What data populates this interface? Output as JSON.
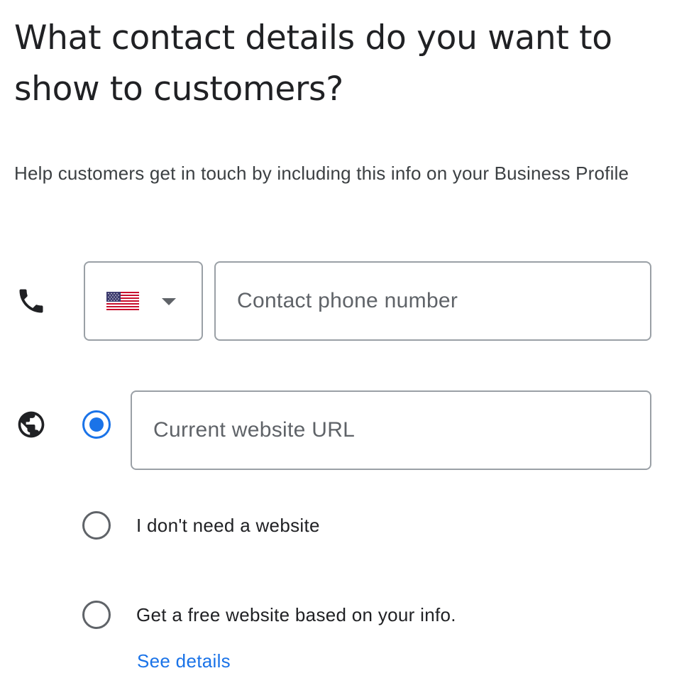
{
  "title": "What contact details do you want to show to customers?",
  "subtitle": "Help customers get in touch by including this info on your Business Profile",
  "phone": {
    "icon": "phone-icon",
    "country_flag": "us-flag-icon",
    "country_code": "US",
    "placeholder": "Contact phone number",
    "value": ""
  },
  "website": {
    "icon": "globe-icon",
    "url_placeholder": "Current website URL",
    "url_value": "",
    "selected_option": "current-website",
    "options": [
      {
        "id": "current-website",
        "label": "",
        "checked": true
      },
      {
        "id": "no-website",
        "label": "I don't need a website",
        "checked": false
      },
      {
        "id": "free-website",
        "label": "Get a free website based on your info.",
        "checked": false
      }
    ],
    "see_details_link": "See details"
  },
  "colors": {
    "accent": "#1a73e8",
    "text_primary": "#202124",
    "text_secondary": "#5f6368",
    "border": "#9aa0a6"
  }
}
